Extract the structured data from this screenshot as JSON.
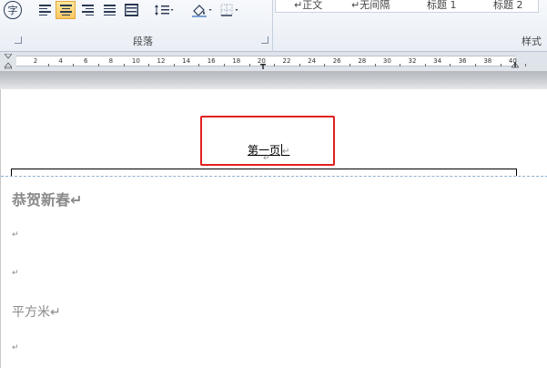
{
  "ribbon": {
    "paragraph_group": {
      "label": "段落",
      "char_icon": "字",
      "buttons": [
        {
          "name": "align-left-icon",
          "active": false
        },
        {
          "name": "align-center-icon",
          "active": true
        },
        {
          "name": "align-right-icon",
          "active": false
        },
        {
          "name": "justify-icon",
          "active": false
        },
        {
          "name": "distributed-icon",
          "active": false
        },
        {
          "name": "line-spacing-icon",
          "active": false
        },
        {
          "name": "shading-icon",
          "active": false
        },
        {
          "name": "borders-icon",
          "active": false
        }
      ]
    },
    "styles_group": {
      "label": "样式",
      "items": [
        "↵正文",
        "↵无间隔",
        "标题 1",
        "标题 2"
      ]
    }
  },
  "ruler": {
    "numbers": [
      "2",
      "4",
      "6",
      "8",
      "10",
      "12",
      "14",
      "16",
      "18",
      "20",
      "22",
      "24",
      "26",
      "28",
      "30",
      "32",
      "34",
      "36",
      "38",
      "40"
    ]
  },
  "document": {
    "header_text": "第一页",
    "paragraph_mark": "↵",
    "heading": "恭贺新春↵",
    "empty_paragraph": "↵",
    "body_text": "平方米↵",
    "highlight_color": "#e02020"
  }
}
